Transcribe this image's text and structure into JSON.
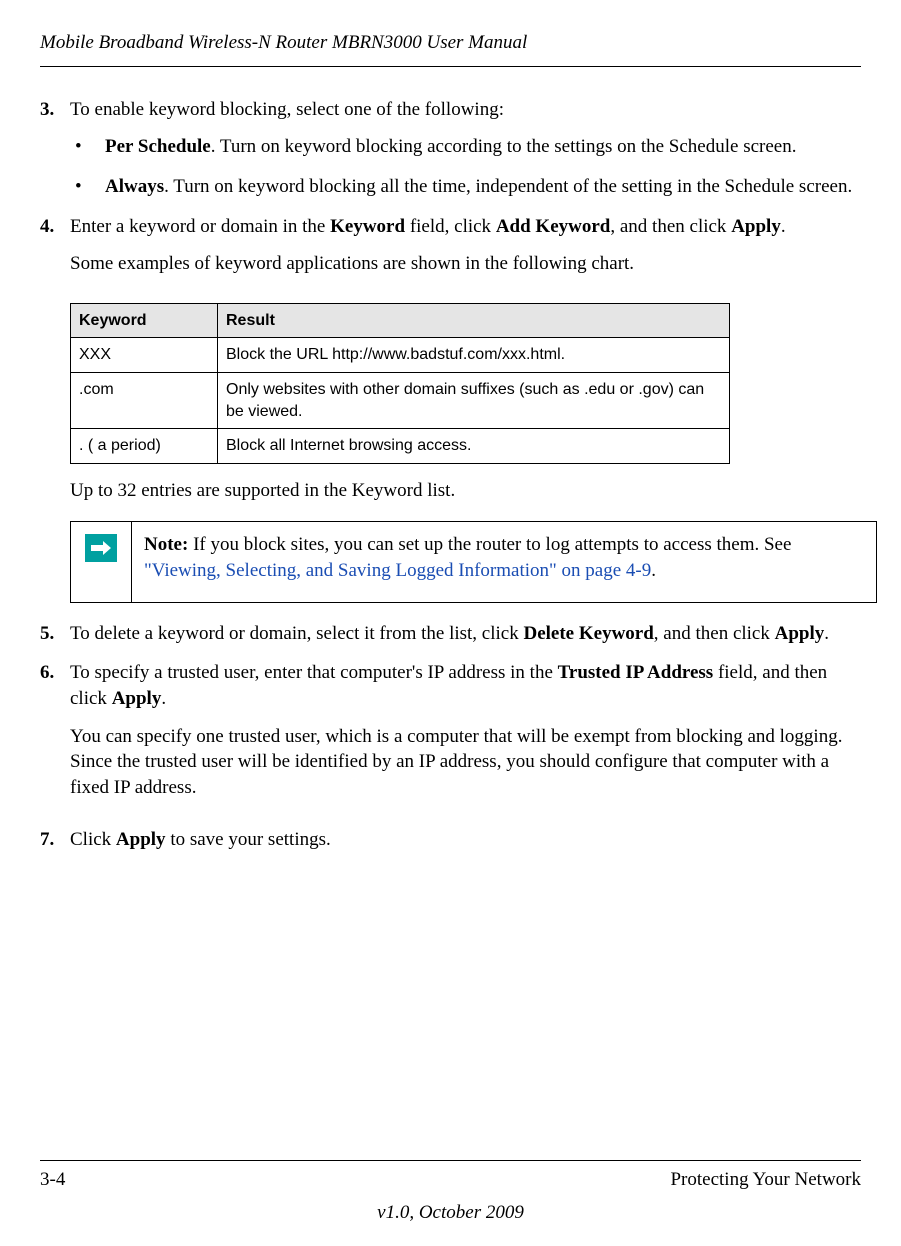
{
  "header": {
    "title": "Mobile Broadband Wireless-N Router MBRN3000 User Manual"
  },
  "steps": {
    "3": {
      "num": "3.",
      "intro": "To enable keyword blocking, select one of the following:",
      "bullets": [
        {
          "label_bold": "Per Schedule",
          "label_rest": ". Turn on keyword blocking according to the settings on the Schedule screen."
        },
        {
          "label_bold": "Always",
          "label_rest": ". Turn on keyword blocking all the time, independent of the setting in the Schedule screen."
        }
      ]
    },
    "4": {
      "num": "4.",
      "line1_pre": "Enter a keyword or domain in the ",
      "line1_bold1": "Keyword",
      "line1_mid1": " field, click ",
      "line1_bold2": "Add Keyword",
      "line1_mid2": ", and then click ",
      "line1_bold3": "Apply",
      "line1_post": ".",
      "para2": "Some examples of keyword applications are shown in the following chart.",
      "table": {
        "headers": [
          "Keyword",
          "Result"
        ],
        "rows": [
          {
            "keyword": "XXX",
            "result": "Block the URL http://www.badstuf.com/xxx.html."
          },
          {
            "keyword": ".com",
            "result": "Only websites with other domain suffixes (such as .edu or .gov) can be viewed."
          },
          {
            "keyword": ". ( a period)",
            "result": "Block all Internet browsing access."
          }
        ]
      },
      "after_table": "Up to 32 entries are supported in the Keyword list."
    },
    "note": {
      "label": "Note:",
      "text": " If you block sites, you can set up the router to log attempts to access them. See ",
      "link": "\"Viewing, Selecting, and Saving Logged Information\" on page 4-9",
      "after": "."
    },
    "5": {
      "num": "5.",
      "pre": "To delete a keyword or domain, select it from the list, click ",
      "bold1": "Delete Keyword",
      "mid": ", and then click ",
      "bold2": "Apply",
      "post": "."
    },
    "6": {
      "num": "6.",
      "pre": "To specify a trusted user, enter that computer's IP address in the ",
      "bold1": "Trusted IP Address",
      "mid": " field, and then click ",
      "bold2": "Apply",
      "post": ".",
      "para2": "You can specify one trusted user, which is a computer that will be exempt from blocking and logging. Since the trusted user will be identified by an IP address, you should configure that computer with a fixed IP address."
    },
    "7": {
      "num": "7.",
      "pre": "Click ",
      "bold1": "Apply",
      "post": " to save your settings."
    }
  },
  "footer": {
    "page_num": "3-4",
    "section": "Protecting Your Network",
    "version": "v1.0, October 2009"
  }
}
